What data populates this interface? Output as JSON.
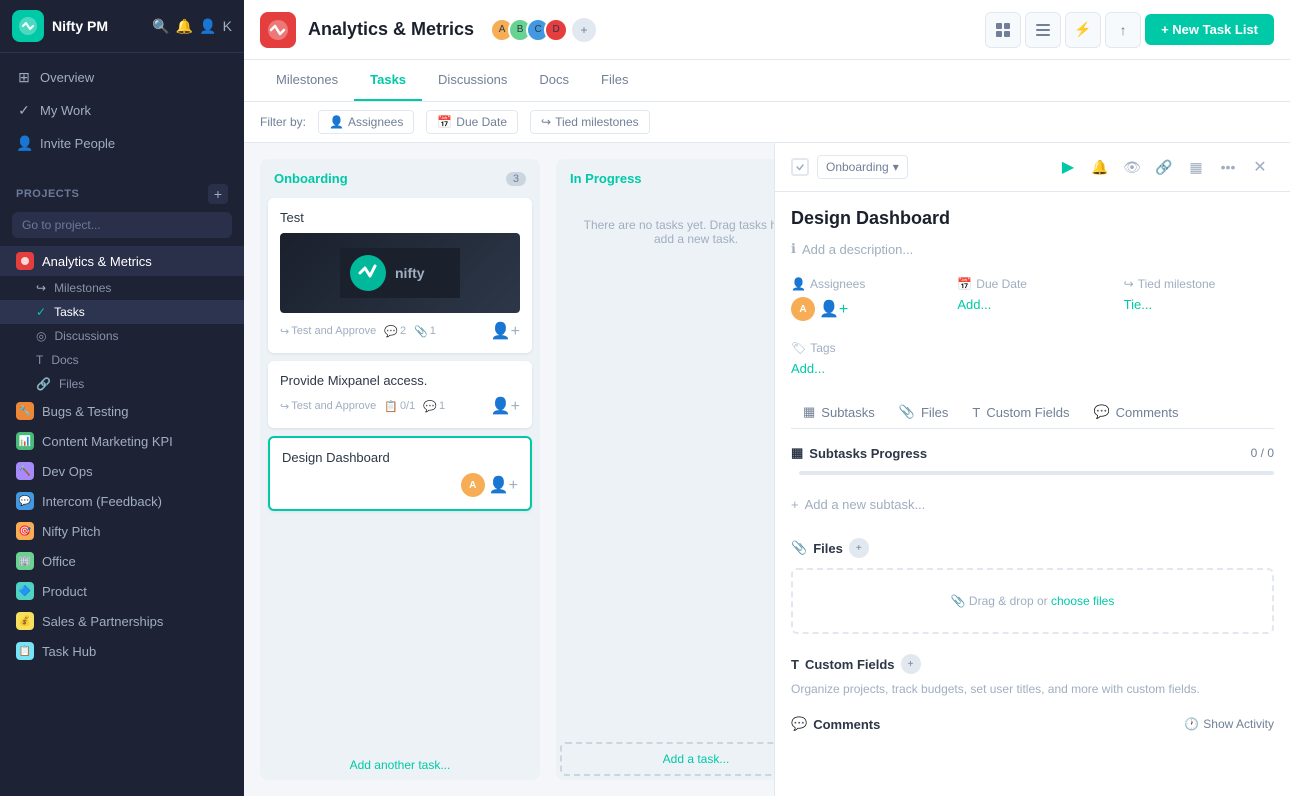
{
  "app": {
    "name": "Nifty PM",
    "logo_letter": "N"
  },
  "sidebar": {
    "nav_items": [
      {
        "id": "overview",
        "label": "Overview",
        "icon": "⊞"
      },
      {
        "id": "my-work",
        "label": "My Work",
        "icon": "✓"
      },
      {
        "id": "invite-people",
        "label": "Invite People",
        "icon": "👤+"
      }
    ],
    "projects_section_label": "PROJECTS",
    "search_placeholder": "Go to project...",
    "projects": [
      {
        "id": "analytics",
        "label": "Analytics & Metrics",
        "color": "#e53e3e",
        "active": true
      },
      {
        "id": "bugs",
        "label": "Bugs & Testing",
        "color": "#ed8936"
      },
      {
        "id": "content-marketing",
        "label": "Content Marketing KPI",
        "color": "#48bb78"
      },
      {
        "id": "devops",
        "label": "Dev Ops",
        "color": "#a78bfa"
      },
      {
        "id": "intercom",
        "label": "Intercom (Feedback)",
        "color": "#4299e1"
      },
      {
        "id": "nifty-pitch",
        "label": "Nifty Pitch",
        "color": "#f6ad55"
      },
      {
        "id": "office",
        "label": "Office",
        "color": "#68d391"
      },
      {
        "id": "product",
        "label": "Product",
        "color": "#4fd1c5"
      },
      {
        "id": "sales",
        "label": "Sales & Partnerships",
        "color": "#f6e05e"
      },
      {
        "id": "task-hub",
        "label": "Task Hub",
        "color": "#76e4f7"
      }
    ],
    "sub_items": [
      {
        "id": "milestones",
        "label": "Milestones",
        "icon": "↪"
      },
      {
        "id": "tasks",
        "label": "Tasks",
        "icon": "✓",
        "active": true
      },
      {
        "id": "discussions",
        "label": "Discussions",
        "icon": "◎"
      },
      {
        "id": "docs",
        "label": "Docs",
        "icon": "T"
      },
      {
        "id": "files",
        "label": "Files",
        "icon": "🔗"
      }
    ]
  },
  "topbar": {
    "project_name": "Analytics & Metrics",
    "new_task_list_label": "+ New Task List"
  },
  "tabs": [
    {
      "id": "milestones",
      "label": "Milestones"
    },
    {
      "id": "tasks",
      "label": "Tasks",
      "active": true
    },
    {
      "id": "discussions",
      "label": "Discussions"
    },
    {
      "id": "docs",
      "label": "Docs"
    },
    {
      "id": "files",
      "label": "Files"
    }
  ],
  "filter_bar": {
    "label": "Filter by:",
    "filters": [
      {
        "id": "assignees",
        "label": "Assignees",
        "icon": "👤"
      },
      {
        "id": "due-date",
        "label": "Due Date",
        "icon": "📅"
      },
      {
        "id": "tied-milestones",
        "label": "Tied milestones",
        "icon": "↪"
      }
    ]
  },
  "kanban": {
    "columns": [
      {
        "id": "onboarding",
        "title": "Onboarding",
        "count": 3,
        "cards": [
          {
            "id": "test",
            "title": "Test",
            "has_image": true,
            "meta_label": "Test and Approve",
            "comments": "2",
            "attachments": "1"
          },
          {
            "id": "provide-mixpanel",
            "title": "Provide  Mixpanel access.",
            "has_image": false,
            "meta_label": "Test and Approve",
            "checklist": "0/1",
            "comments": "1"
          },
          {
            "id": "design-dashboard",
            "title": "Design Dashboard",
            "has_image": false,
            "meta_label": ""
          }
        ],
        "add_task_label": "Add another task..."
      },
      {
        "id": "in-progress",
        "title": "In Progress",
        "count": null,
        "empty_text": "There are no tasks yet. Drag tasks here or add a new task.",
        "add_task_label": "Add a task..."
      }
    ]
  },
  "task_panel": {
    "status_label": "Onboarding",
    "status_chevron": "▾",
    "task_title": "Design Dashboard",
    "description_placeholder": "Add a description...",
    "assignees_label": "Assignees",
    "due_date_label": "Due Date",
    "due_date_value": "Add...",
    "tied_milestone_label": "Tied milestone",
    "tied_milestone_value": "Tie...",
    "tags_label": "Tags",
    "tags_add": "Add...",
    "tabs": [
      {
        "id": "subtasks",
        "label": "Subtasks",
        "icon": "▦"
      },
      {
        "id": "files",
        "label": "Files",
        "icon": "📎"
      },
      {
        "id": "custom-fields",
        "label": "Custom Fields",
        "icon": "T"
      },
      {
        "id": "comments",
        "label": "Comments",
        "icon": "💬"
      }
    ],
    "subtasks_title": "Subtasks Progress",
    "subtasks_progress": "0 / 0",
    "add_subtask_label": "Add a new subtask...",
    "files_title": "Files",
    "drop_text": "Drag & drop or ",
    "choose_files_text": "choose files",
    "custom_fields_title": "Custom Fields",
    "custom_fields_desc": "Organize projects, track budgets, set user titles, and more with custom fields.",
    "comments_title": "Comments",
    "show_activity_label": "Show Activity"
  }
}
